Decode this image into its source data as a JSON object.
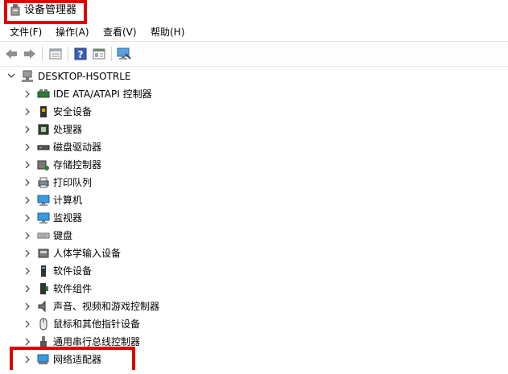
{
  "window": {
    "title": "设备管理器"
  },
  "menu": [
    "文件(F)",
    "操作(A)",
    "查看(V)",
    "帮助(H)"
  ],
  "toolbar": {
    "buttons": [
      "back-icon",
      "forward-icon",
      "properties-icon",
      "help-icon",
      "view-icon",
      "monitor-scan-icon"
    ]
  },
  "tree": {
    "root": "DESKTOP-HSOTRLE",
    "items": [
      {
        "label": "IDE ATA/ATAPI 控制器",
        "icon": "ide-controller-icon"
      },
      {
        "label": "安全设备",
        "icon": "security-device-icon"
      },
      {
        "label": "处理器",
        "icon": "processor-icon"
      },
      {
        "label": "磁盘驱动器",
        "icon": "disk-drive-icon"
      },
      {
        "label": "存储控制器",
        "icon": "storage-controller-icon"
      },
      {
        "label": "打印队列",
        "icon": "print-queue-icon"
      },
      {
        "label": "计算机",
        "icon": "computer-icon"
      },
      {
        "label": "监视器",
        "icon": "monitor-icon"
      },
      {
        "label": "键盘",
        "icon": "keyboard-icon"
      },
      {
        "label": "人体学输入设备",
        "icon": "hid-icon"
      },
      {
        "label": "软件设备",
        "icon": "software-device-icon"
      },
      {
        "label": "软件组件",
        "icon": "software-component-icon"
      },
      {
        "label": "声音、视频和游戏控制器",
        "icon": "sound-icon"
      },
      {
        "label": "鼠标和其他指针设备",
        "icon": "mouse-icon"
      },
      {
        "label": "通用串行总线控制器",
        "icon": "usb-icon"
      },
      {
        "label": "网络适配器",
        "icon": "network-adapter-icon"
      }
    ]
  },
  "colors": {
    "annotation": "#e00000",
    "accent": "#2a7ad5"
  }
}
